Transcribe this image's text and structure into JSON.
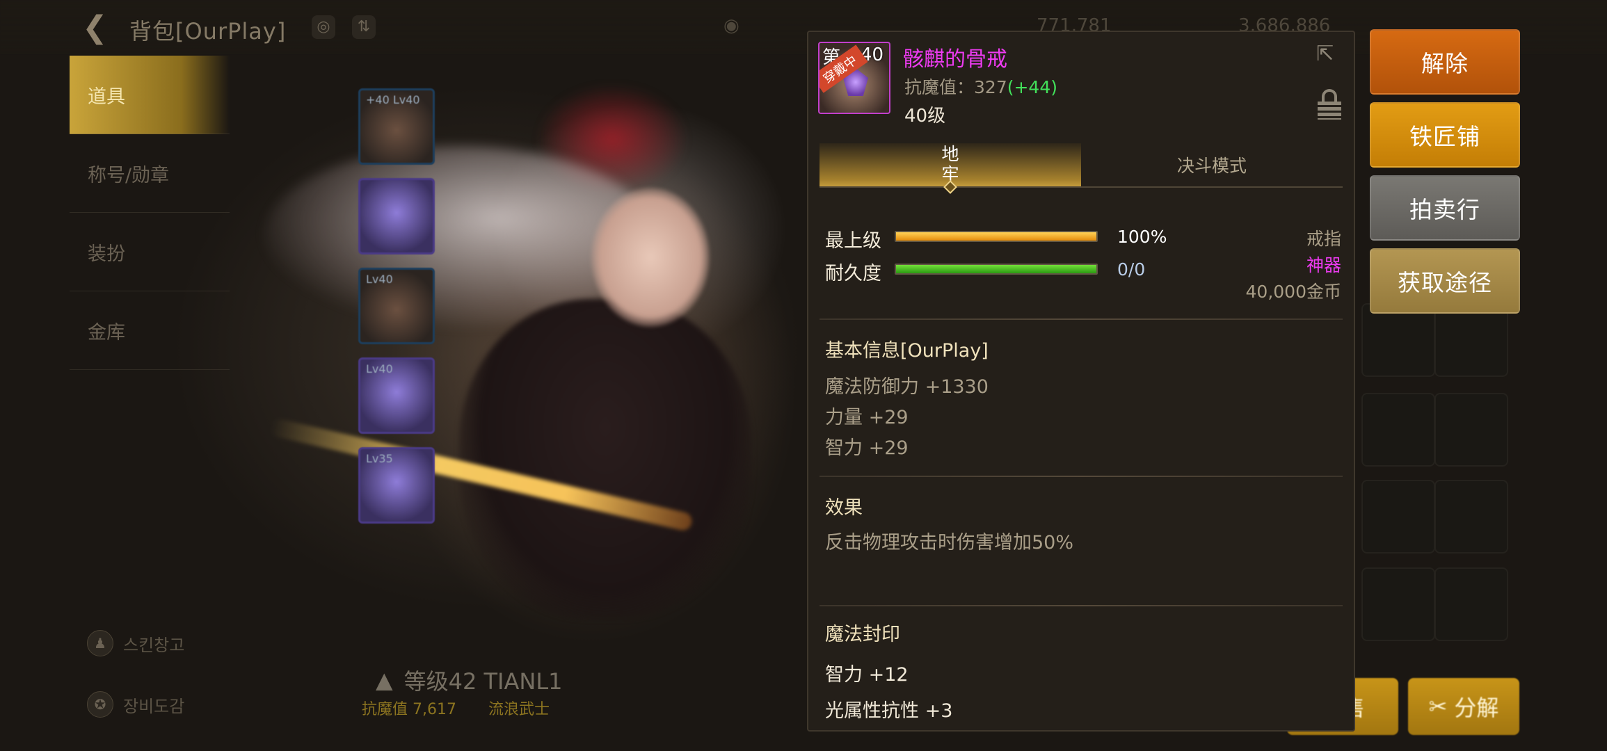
{
  "header": {
    "title": "背包[OurPlay]",
    "gold_amount": "3,686,886",
    "gem_amount": "771,781"
  },
  "left_menu": {
    "items": [
      {
        "label": "道具",
        "active": true
      },
      {
        "label": "称号/勋章",
        "active": false
      },
      {
        "label": "装扮",
        "active": false
      },
      {
        "label": "金库",
        "active": false
      }
    ],
    "bottom_links": [
      {
        "label": "스킨창고"
      },
      {
        "label": "장비도감"
      }
    ]
  },
  "equipment": {
    "slots": [
      {
        "label": "+40 Lv40"
      },
      {
        "label": ""
      },
      {
        "label": "Lv40"
      },
      {
        "label": "Lv40"
      },
      {
        "label": "Lv35"
      }
    ]
  },
  "character": {
    "level_label": "等级42 TIANL1",
    "resist_label": "抗魔值 7,617",
    "class_label": "流浪武士"
  },
  "item": {
    "icon_prefix": "第",
    "icon_level": "40",
    "equipped_tag": "穿戴中",
    "name": "骸麒的骨戒",
    "name_color": "#ee3bf2",
    "resist_label": "抗魔值：",
    "resist_value": "327",
    "resist_bonus": "(+44)",
    "level_text": "40级",
    "type": "戒指",
    "grade": "神器",
    "grade_color": "#ee3bf2",
    "price": "40,000金币"
  },
  "tabs": [
    {
      "label": "地牢",
      "active": true
    },
    {
      "label": "决斗模式",
      "active": false
    }
  ],
  "stats": {
    "top_level_label": "最上级",
    "top_level_value": "100%",
    "top_level_fraction": 1.0,
    "durability_label": "耐久度",
    "durability_value": "0/0",
    "durability_fraction": 1.0
  },
  "basic_info": {
    "title": "基本信息[OurPlay]",
    "lines": [
      "魔法防御力 +1330",
      "力量 +29",
      "智力 +29"
    ]
  },
  "effect": {
    "title": "效果",
    "text": "反击物理攻击时伤害增加50%"
  },
  "seal": {
    "title": "魔法封印",
    "lines": [
      "智力 +12",
      "光属性抗性 +3"
    ]
  },
  "actions": {
    "remove": "解除",
    "blacksmith": "铁匠铺",
    "auction": "拍卖行",
    "obtain": "获取途径",
    "sell": "出售",
    "disassemble": "分解"
  },
  "colors": {
    "remove_btn": "#c5600e",
    "blacksmith_btn": "#d68e0d",
    "auction_btn": "#6d6b66",
    "obtain_btn": "#a78a4a"
  }
}
